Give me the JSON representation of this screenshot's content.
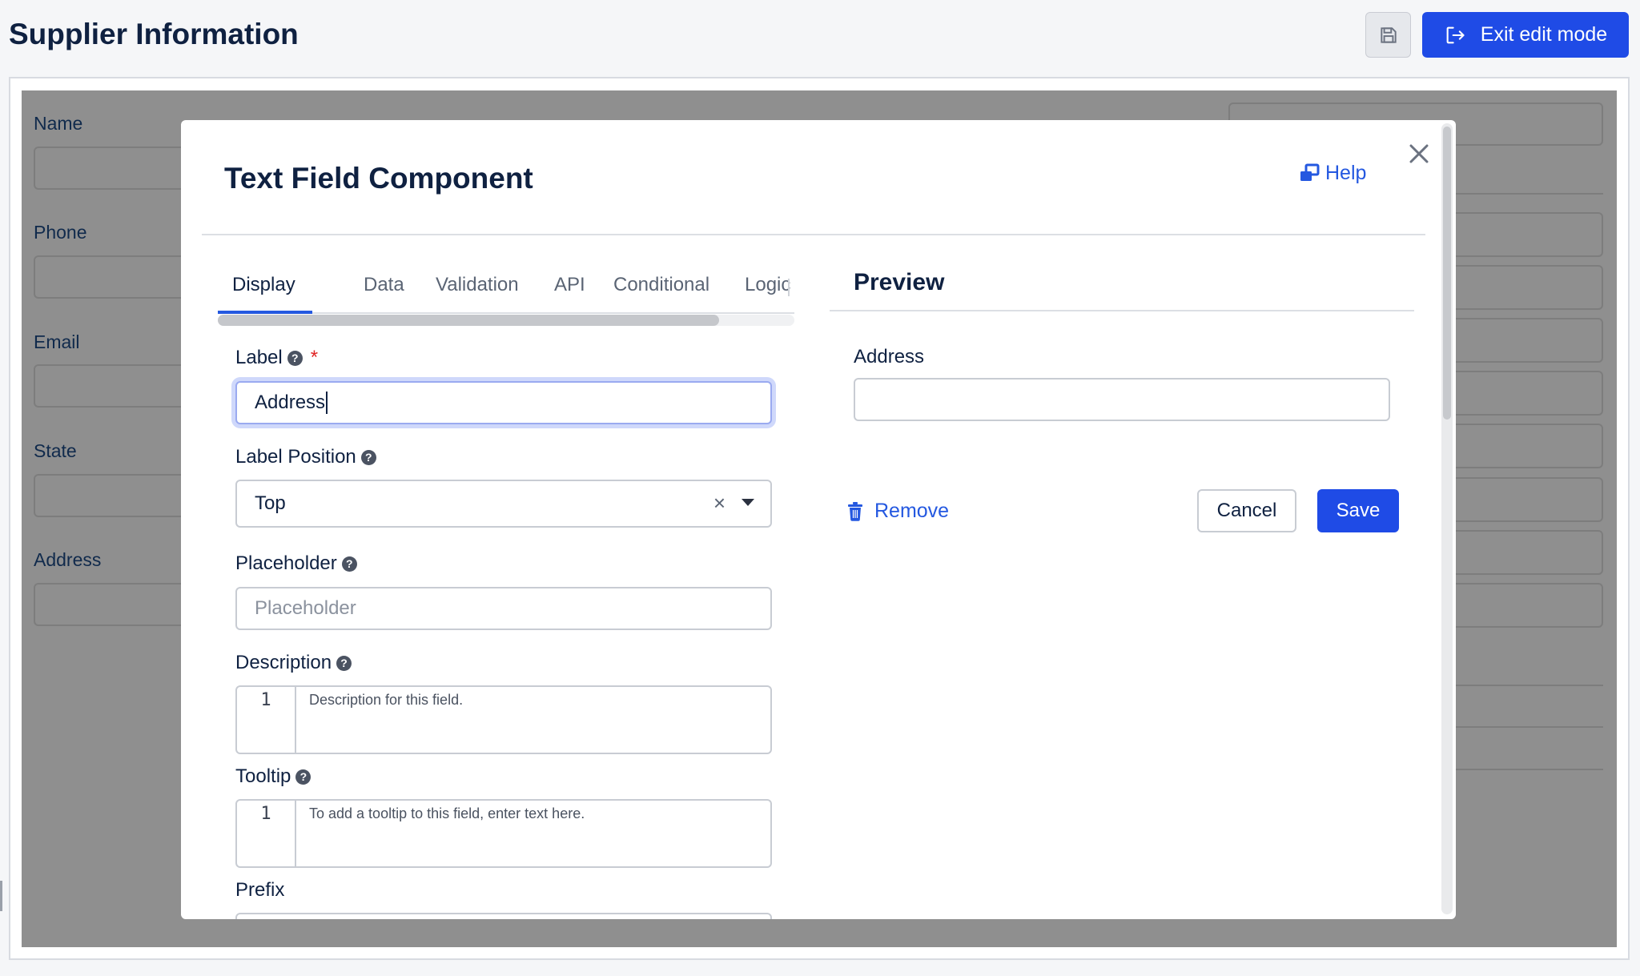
{
  "header": {
    "title": "Supplier Information",
    "save_icon": "floppy-disk-icon",
    "exit_button": {
      "label": "Exit edit mode",
      "icon": "sign-out-icon"
    }
  },
  "background_form": {
    "fields": [
      {
        "label": "Name"
      },
      {
        "label": "Phone"
      },
      {
        "label": "Email"
      },
      {
        "label": "State"
      },
      {
        "label": "Address"
      }
    ]
  },
  "modal": {
    "title": "Text Field Component",
    "help_label": "Help",
    "tabs": [
      {
        "label": "Display",
        "active": true
      },
      {
        "label": "Data",
        "active": false
      },
      {
        "label": "Validation",
        "active": false
      },
      {
        "label": "API",
        "active": false
      },
      {
        "label": "Conditional",
        "active": false
      },
      {
        "label": "Logic",
        "active": false
      }
    ],
    "tab_scroll_fraction": 0.87,
    "fields": {
      "label": {
        "label": "Label",
        "required_marker": "*",
        "value": "Address"
      },
      "label_position": {
        "label": "Label Position",
        "value": "Top",
        "clear": "×"
      },
      "placeholder": {
        "label": "Placeholder",
        "placeholder": "Placeholder"
      },
      "description": {
        "label": "Description",
        "line_number": "1",
        "placeholder": "Description for this field."
      },
      "tooltip": {
        "label": "Tooltip",
        "line_number": "1",
        "placeholder": "To add a tooltip to this field, enter text here."
      },
      "prefix": {
        "label": "Prefix"
      }
    },
    "preview": {
      "title": "Preview",
      "field_label": "Address"
    },
    "actions": {
      "remove_label": "Remove",
      "cancel_label": "Cancel",
      "save_label": "Save"
    }
  },
  "colors": {
    "primary": "#1f4be6",
    "link": "#2458e0",
    "heading": "#0f2141",
    "required": "#e02424",
    "backdrop": "#8f8f8f"
  }
}
